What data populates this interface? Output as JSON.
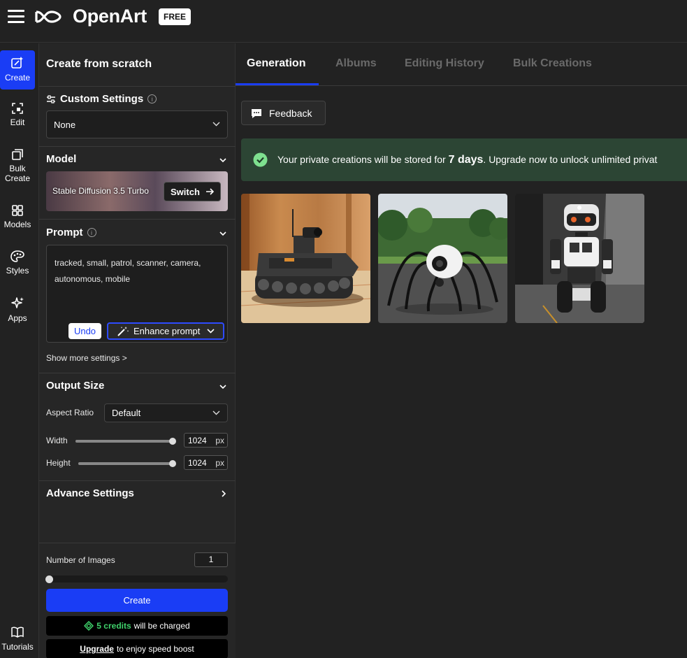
{
  "header": {
    "brand": "OpenArt",
    "plan_badge": "FREE"
  },
  "rail": {
    "items": [
      {
        "label": "Create",
        "icon": "create-icon"
      },
      {
        "label": "Edit",
        "icon": "edit-icon"
      },
      {
        "label": "Bulk Create",
        "icon": "bulk-create-icon"
      },
      {
        "label": "Models",
        "icon": "models-icon"
      },
      {
        "label": "Styles",
        "icon": "styles-icon"
      },
      {
        "label": "Apps",
        "icon": "apps-icon"
      }
    ],
    "tutorials": "Tutorials"
  },
  "panel": {
    "title": "Create from scratch",
    "custom_settings": {
      "title": "Custom Settings",
      "value": "None"
    },
    "model": {
      "title": "Model",
      "name": "Stable Diffusion 3.5 Turbo",
      "switch_label": "Switch"
    },
    "prompt": {
      "title": "Prompt",
      "text": "tracked, small, patrol, scanner, camera, autonomous, mobile",
      "undo_label": "Undo",
      "enhance_label": "Enhance prompt"
    },
    "show_more": "Show more settings >",
    "output_size": {
      "title": "Output Size",
      "aspect_label": "Aspect Ratio",
      "aspect_value": "Default",
      "width_label": "Width",
      "width_value": "1024",
      "height_label": "Height",
      "height_value": "1024",
      "unit": "px"
    },
    "advance": {
      "title": "Advance Settings"
    },
    "bottom": {
      "num_images_label": "Number of Images",
      "num_images_value": "1",
      "create_label": "Create",
      "credits_amount": "5 credits",
      "credits_suffix": "will be charged",
      "upgrade_link": "Upgrade",
      "upgrade_suffix": "to enjoy speed boost"
    }
  },
  "main": {
    "tabs": [
      {
        "label": "Generation",
        "active": true
      },
      {
        "label": "Albums",
        "active": false
      },
      {
        "label": "Editing History",
        "active": false
      },
      {
        "label": "Bulk Creations",
        "active": false
      }
    ],
    "feedback_label": "Feedback",
    "notice": {
      "prefix": "Your private creations will be stored for",
      "days": "7 days",
      "suffix": ". Upgrade now to unlock unlimited privat"
    }
  },
  "colors": {
    "accent": "#1a3df5",
    "background": "#222222",
    "panel": "#262626",
    "notice_bg": "#2c4534",
    "success_green": "#3fd26b"
  }
}
